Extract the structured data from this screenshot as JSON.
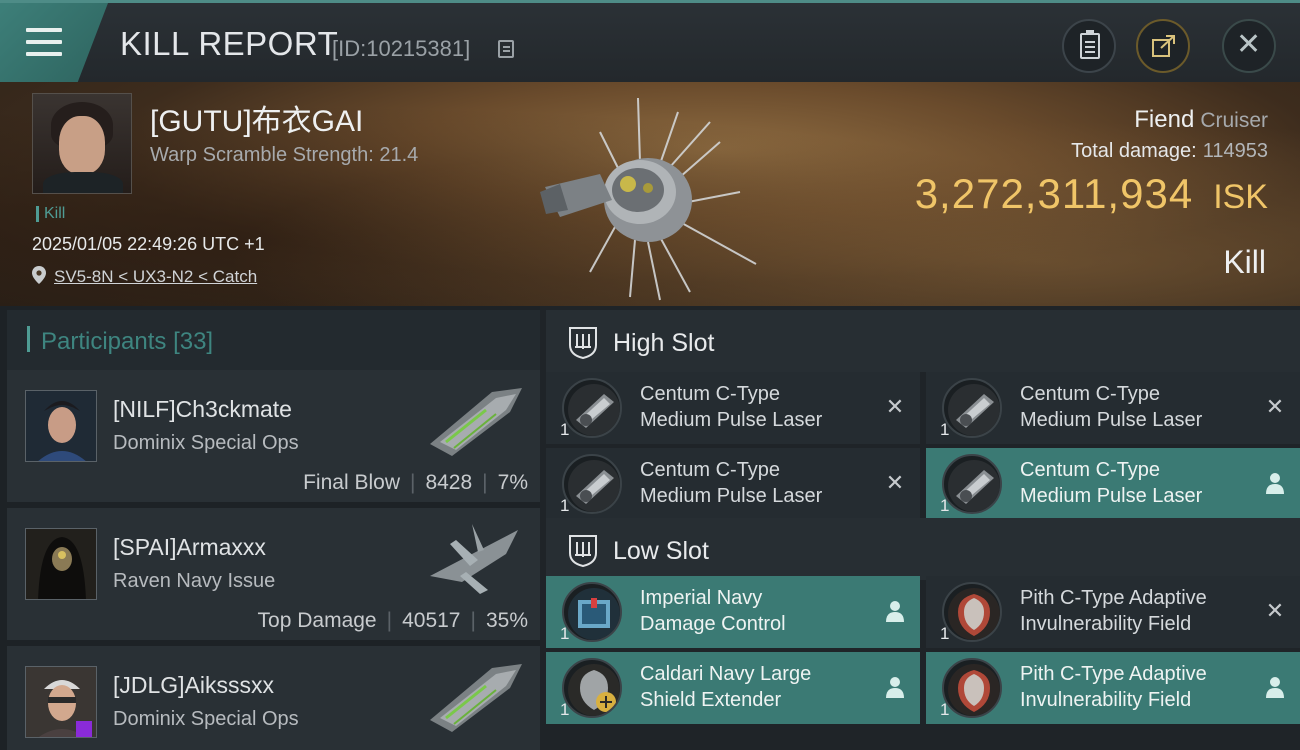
{
  "header": {
    "title": "KILL REPORT",
    "report_id": "[ID:10215381]",
    "menu_icon": "hamburger-menu-icon",
    "buttons": [
      "clipboard-icon",
      "share-icon",
      "close-icon"
    ]
  },
  "victim": {
    "name": "[GUTU]布衣GAI",
    "warp_scramble": "Warp Scramble Strength: 21.4",
    "tag": "Kill",
    "timestamp": "2025/01/05 22:49:26 UTC +1",
    "location": "SV5-8N < UX3-N2 < Catch"
  },
  "summary": {
    "ship": "Fiend",
    "ship_class": "Cruiser",
    "total_damage_label": "Total damage:",
    "total_damage": "114953",
    "isk_value": "3,272,311,934",
    "isk_unit": "ISK",
    "result": "Kill"
  },
  "participants": {
    "label": "Participants",
    "count": "[33]",
    "items": [
      {
        "name": "[NILF]Ch3ckmate",
        "ship": "Dominix Special Ops",
        "role": "Final Blow",
        "damage": "8428",
        "percent": "7%"
      },
      {
        "name": "[SPAI]Armaxxx",
        "ship": "Raven Navy Issue",
        "role": "Top Damage",
        "damage": "40517",
        "percent": "35%"
      },
      {
        "name": "[JDLG]Aiksssxx",
        "ship": "Dominix Special Ops",
        "role": "",
        "damage": "",
        "percent": ""
      }
    ]
  },
  "fitting": {
    "high_slot": {
      "label": "High Slot",
      "modules": [
        {
          "line1": "Centum C-Type",
          "line2": "Medium Pulse Laser",
          "qty": "1",
          "status": "destroyed"
        },
        {
          "line1": "Centum C-Type",
          "line2": "Medium Pulse Laser",
          "qty": "1",
          "status": "destroyed"
        },
        {
          "line1": "Centum C-Type",
          "line2": "Medium Pulse Laser",
          "qty": "1",
          "status": "destroyed"
        },
        {
          "line1": "Centum C-Type",
          "line2": "Medium Pulse Laser",
          "qty": "1",
          "status": "dropped"
        }
      ]
    },
    "low_slot": {
      "label": "Low Slot",
      "modules": [
        {
          "line1": "Imperial Navy",
          "line2": "Damage Control",
          "qty": "1",
          "status": "dropped"
        },
        {
          "line1": "Pith C-Type Adaptive",
          "line2": "Invulnerability Field",
          "qty": "1",
          "status": "destroyed"
        },
        {
          "line1": "Caldari Navy Large",
          "line2": "Shield Extender",
          "qty": "1",
          "status": "dropped"
        },
        {
          "line1": "Pith C-Type Adaptive",
          "line2": "Invulnerability Field",
          "qty": "1",
          "status": "dropped"
        }
      ]
    }
  },
  "colors": {
    "accent": "#3b7a74",
    "isk": "#f0c568",
    "panel": "#252c31"
  }
}
